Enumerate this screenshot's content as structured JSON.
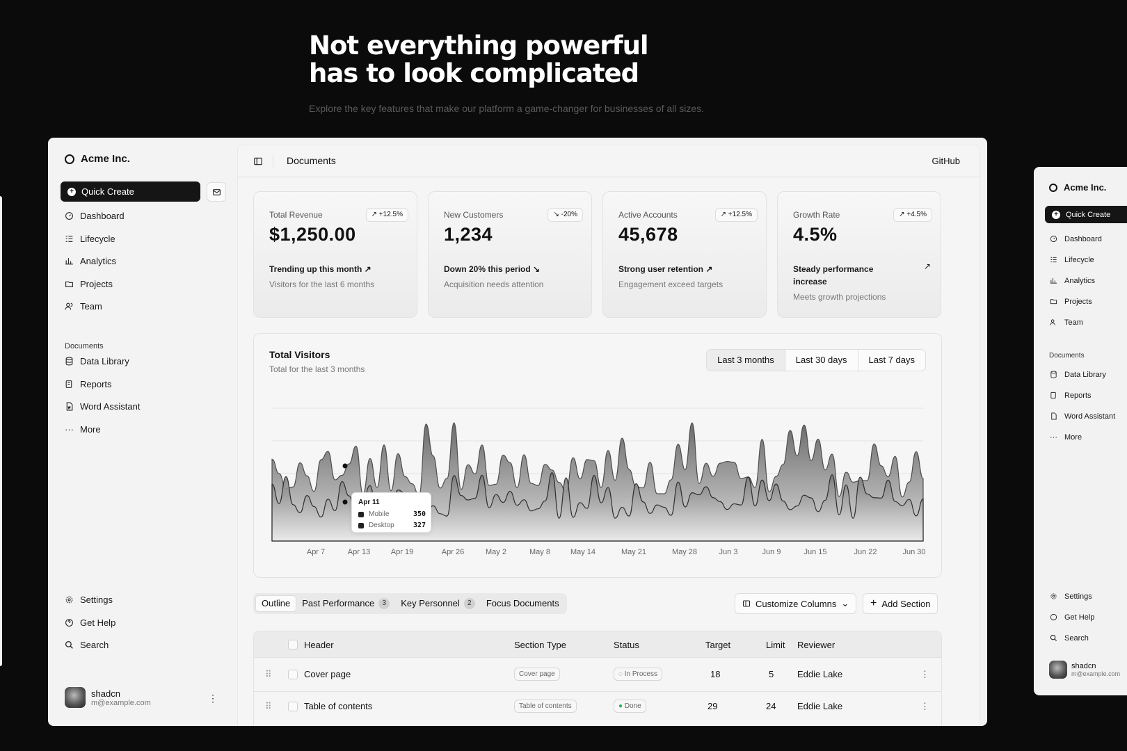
{
  "hero": {
    "line1": "Not everything powerful",
    "line2": "has to look complicated",
    "subtitle": "Explore the key features that make our platform a game-changer for businesses of all sizes."
  },
  "sidebar": {
    "brand": "Acme Inc.",
    "quick_create": "Quick Create",
    "nav": [
      {
        "label": "Dashboard",
        "icon": "gauge-icon"
      },
      {
        "label": "Lifecycle",
        "icon": "list-icon"
      },
      {
        "label": "Analytics",
        "icon": "chart-bar-icon"
      },
      {
        "label": "Projects",
        "icon": "folder-icon"
      },
      {
        "label": "Team",
        "icon": "users-icon"
      }
    ],
    "documents_heading": "Documents",
    "docs": [
      {
        "label": "Data Library",
        "icon": "database-icon"
      },
      {
        "label": "Reports",
        "icon": "report-icon"
      },
      {
        "label": "Word Assistant",
        "icon": "file-word-icon"
      },
      {
        "label": "More",
        "icon": "dots-icon"
      }
    ],
    "bottom": [
      {
        "label": "Settings",
        "icon": "gear-icon"
      },
      {
        "label": "Get Help",
        "icon": "help-icon"
      },
      {
        "label": "Search",
        "icon": "search-icon"
      }
    ],
    "user": {
      "name": "shadcn",
      "email": "m@example.com"
    }
  },
  "topbar": {
    "title": "Documents",
    "github": "GitHub"
  },
  "cards": [
    {
      "label": "Total Revenue",
      "badge": "+12.5%",
      "value": "$1,250.00",
      "trend": "Trending up this month",
      "sub": "Visitors for the last 6 months"
    },
    {
      "label": "New Customers",
      "badge": "-20%",
      "value": "1,234",
      "trend": "Down 20% this period",
      "sub": "Acquisition needs attention"
    },
    {
      "label": "Active Accounts",
      "badge": "+12.5%",
      "value": "45,678",
      "trend": "Strong user retention",
      "sub": "Engagement exceed targets"
    },
    {
      "label": "Growth Rate",
      "badge": "+4.5%",
      "value": "4.5%",
      "trend": "Steady performance increase",
      "sub": "Meets growth projections"
    }
  ],
  "visitors": {
    "title": "Total Visitors",
    "subtitle": "Total for the last 3 months",
    "ranges": [
      "Last 3 months",
      "Last 30 days",
      "Last 7 days"
    ],
    "x_labels": [
      "Apr 7",
      "Apr 13",
      "Apr 19",
      "Apr 26",
      "May 2",
      "May 8",
      "May 14",
      "May 21",
      "May 28",
      "Jun 3",
      "Jun 9",
      "Jun 15",
      "Jun 22",
      "Jun 30"
    ],
    "tooltip": {
      "date": "Apr 11",
      "mobile_label": "Mobile",
      "mobile": "350",
      "desktop_label": "Desktop",
      "desktop": "327"
    }
  },
  "tabs": [
    {
      "label": "Outline"
    },
    {
      "label": "Past Performance",
      "count": "3"
    },
    {
      "label": "Key Personnel",
      "count": "2"
    },
    {
      "label": "Focus Documents"
    }
  ],
  "actions": {
    "customize": "Customize Columns",
    "add": "Add Section"
  },
  "table": {
    "headers": [
      "Header",
      "Section Type",
      "Status",
      "Target",
      "Limit",
      "Reviewer"
    ],
    "rows": [
      {
        "header": "Cover page",
        "type": "Cover page",
        "status": "In Process",
        "target": "18",
        "limit": "5",
        "reviewer": "Eddie Lake"
      },
      {
        "header": "Table of contents",
        "type": "Table of contents",
        "status": "Done",
        "target": "29",
        "limit": "24",
        "reviewer": "Eddie Lake"
      }
    ]
  },
  "mini": {
    "brand": "Acme Inc.",
    "quick_create": "Quick Create",
    "nav": [
      "Dashboard",
      "Lifecycle",
      "Analytics",
      "Projects",
      "Team"
    ],
    "documents_heading": "Documents",
    "docs": [
      "Data Library",
      "Reports",
      "Word Assistant",
      "More"
    ],
    "bottom": [
      "Settings",
      "Get Help",
      "Search"
    ],
    "user": {
      "name": "shadcn",
      "email": "m@example.com"
    }
  }
}
